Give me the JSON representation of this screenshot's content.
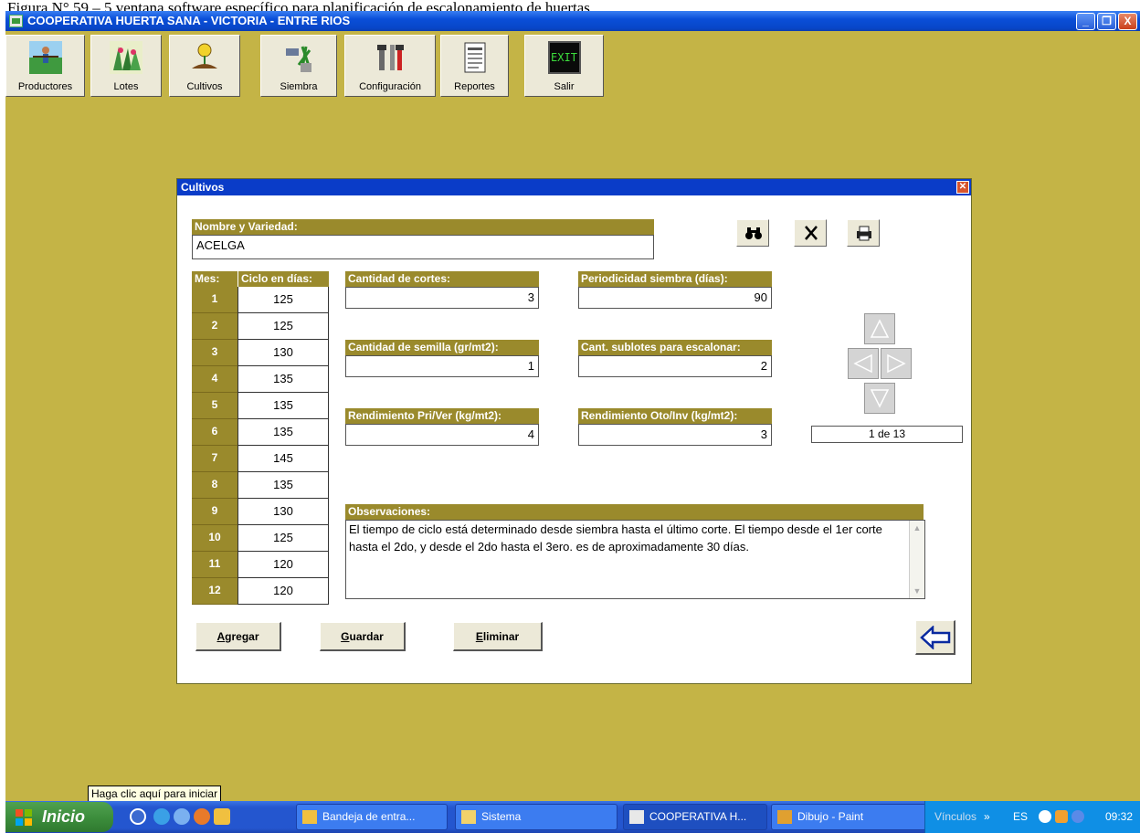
{
  "caption": "Figura N° 59 – 5 ventana software específico para planificación de escalonamiento de huertas",
  "app": {
    "title": "COOPERATIVA HUERTA SANA - VICTORIA - ENTRE RIOS",
    "minimize_icon": "minimize-icon",
    "restore_icon": "restore-icon",
    "close_icon": "close-icon"
  },
  "toolbar": {
    "productores": "Productores",
    "lotes": "Lotes",
    "cultivos": "Cultivos",
    "siembra": "Siembra",
    "configuracion": "Configuración",
    "reportes": "Reportes",
    "salir": "Salir",
    "exit_sign": "EXIT"
  },
  "dialog": {
    "title": "Cultivos",
    "nombre_label": "Nombre y Variedad:",
    "nombre_value": "ACELGA",
    "mes_label": "Mes:",
    "ciclo_label": "Ciclo en días:",
    "months": [
      {
        "mes": "1",
        "ciclo": "125"
      },
      {
        "mes": "2",
        "ciclo": "125"
      },
      {
        "mes": "3",
        "ciclo": "130"
      },
      {
        "mes": "4",
        "ciclo": "135"
      },
      {
        "mes": "5",
        "ciclo": "135"
      },
      {
        "mes": "6",
        "ciclo": "135"
      },
      {
        "mes": "7",
        "ciclo": "145"
      },
      {
        "mes": "8",
        "ciclo": "135"
      },
      {
        "mes": "9",
        "ciclo": "130"
      },
      {
        "mes": "10",
        "ciclo": "125"
      },
      {
        "mes": "11",
        "ciclo": "120"
      },
      {
        "mes": "12",
        "ciclo": "120"
      }
    ],
    "cortes_label": "Cantidad de cortes:",
    "cortes_value": "3",
    "periodicidad_label": "Periodicidad siembra (días):",
    "periodicidad_value": "90",
    "semilla_label": "Cantidad de semilla (gr/mt2):",
    "semilla_value": "1",
    "sublotes_label": "Cant. sublotes para escalonar:",
    "sublotes_value": "2",
    "rend_priver_label": "Rendimiento Pri/Ver (kg/mt2):",
    "rend_priver_value": "4",
    "rend_otoinv_label": "Rendimiento Oto/Inv (kg/mt2):",
    "rend_otoinv_value": "3",
    "record_position": "1 de 13",
    "observaciones_label": "Observaciones:",
    "observaciones_value": "El tiempo de ciclo está determinado desde siembra hasta el último corte. El tiempo desde el 1er corte hasta el 2do, y desde el 2do hasta el 3ero. es de aproximadamente 30 días.",
    "agregar_first": "A",
    "agregar_rest": "gregar",
    "guardar_first": "G",
    "guardar_rest": "uardar",
    "eliminar_first": "E",
    "eliminar_rest": "liminar"
  },
  "taskbar": {
    "tooltip": "Haga clic aquí para iniciar",
    "start_label": "Inicio",
    "tasks": [
      {
        "label": "Bandeja de entra..."
      },
      {
        "label": "Sistema"
      },
      {
        "label": "COOPERATIVA H..."
      },
      {
        "label": "Dibujo - Paint"
      }
    ],
    "tray_links": "Vínculos",
    "tray_chevron": "»",
    "tray_lang": "ES",
    "clock": "09:32"
  },
  "colors": {
    "background": "#C4B446",
    "header_olive": "#9a8a2c",
    "dialog_title": "#0a3cc8",
    "taskbar": "#2456cf"
  }
}
